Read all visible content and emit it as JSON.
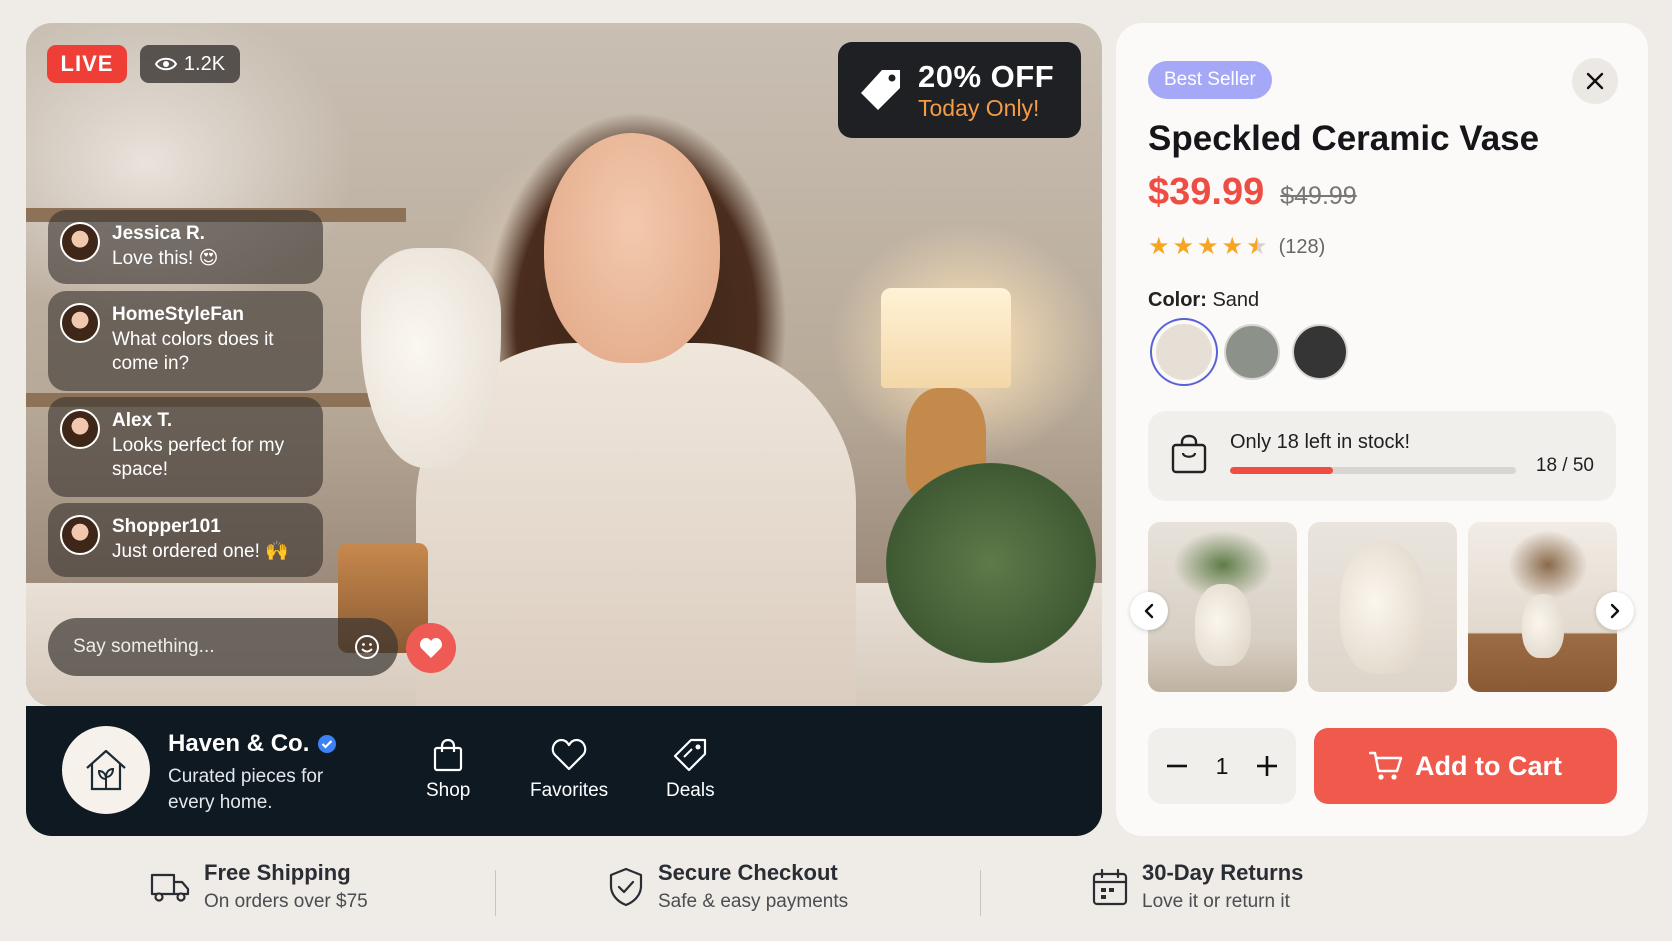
{
  "stream": {
    "live_label": "LIVE",
    "viewer_count": "1.2K",
    "promo": {
      "main": "20% OFF",
      "sub": "Today Only!"
    },
    "chat": [
      {
        "user": "Jessica R.",
        "message": "Love this! 😍"
      },
      {
        "user": "HomeStyleFan",
        "message": "What colors does it come in?"
      },
      {
        "user": "Alex T.",
        "message": "Looks perfect for my space!"
      },
      {
        "user": "Shopper101",
        "message": "Just ordered one! 🙌"
      }
    ],
    "chat_input_placeholder": "Say something..."
  },
  "store": {
    "name": "Haven & Co.",
    "tagline": "Curated pieces for every home.",
    "nav": [
      {
        "label": "Shop",
        "icon": "shopping-bag-icon"
      },
      {
        "label": "Favorites",
        "icon": "heart-icon"
      },
      {
        "label": "Deals",
        "icon": "tag-icon"
      }
    ]
  },
  "product": {
    "badge": "Best Seller",
    "title": "Speckled Ceramic Vase",
    "price": "$39.99",
    "original_price": "$49.99",
    "rating": 4.5,
    "review_count": "(128)",
    "color_label": "Color:",
    "color_value": "Sand",
    "colors": [
      {
        "name": "Sand",
        "hex": "#e6dfd6",
        "selected": true
      },
      {
        "name": "Sage",
        "hex": "#8c918a",
        "selected": false
      },
      {
        "name": "Charcoal",
        "hex": "#353535",
        "selected": false
      }
    ],
    "stock_message": "Only 18 left in stock!",
    "stock_count": "18 / 50",
    "stock_fraction": 0.36,
    "quantity": "1",
    "add_to_cart_label": "Add to Cart"
  },
  "features": [
    {
      "title": "Free Shipping",
      "subtitle": "On orders over $75",
      "icon": "truck-icon"
    },
    {
      "title": "Secure Checkout",
      "subtitle": "Safe & easy payments",
      "icon": "shield-check-icon"
    },
    {
      "title": "30-Day Returns",
      "subtitle": "Love it or return it",
      "icon": "calendar-icon"
    }
  ],
  "colors": {
    "accent": "#ef5a4d",
    "live_red": "#ef3e36",
    "promo_orange": "#f59a45",
    "badge_purple": "#a5a8f6",
    "store_bar": "#0e1922"
  }
}
